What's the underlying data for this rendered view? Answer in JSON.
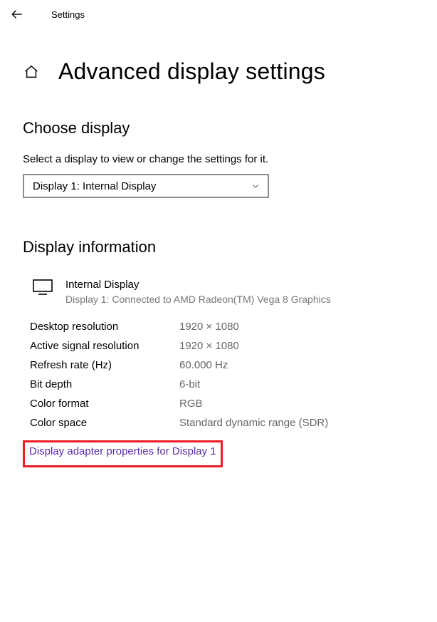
{
  "titlebar": {
    "app_name": "Settings"
  },
  "page": {
    "title": "Advanced display settings"
  },
  "choose_display": {
    "heading": "Choose display",
    "description": "Select a display to view or change the settings for it.",
    "selected": "Display 1: Internal Display"
  },
  "display_info": {
    "heading": "Display information",
    "name": "Internal Display",
    "connection": "Display 1: Connected to AMD Radeon(TM) Vega 8 Graphics",
    "specs": [
      {
        "label": "Desktop resolution",
        "value": "1920 × 1080"
      },
      {
        "label": "Active signal resolution",
        "value": "1920 × 1080"
      },
      {
        "label": "Refresh rate (Hz)",
        "value": "60.000 Hz"
      },
      {
        "label": "Bit depth",
        "value": "6-bit"
      },
      {
        "label": "Color format",
        "value": "RGB"
      },
      {
        "label": "Color space",
        "value": "Standard dynamic range (SDR)"
      }
    ],
    "adapter_link": "Display adapter properties for Display 1"
  }
}
